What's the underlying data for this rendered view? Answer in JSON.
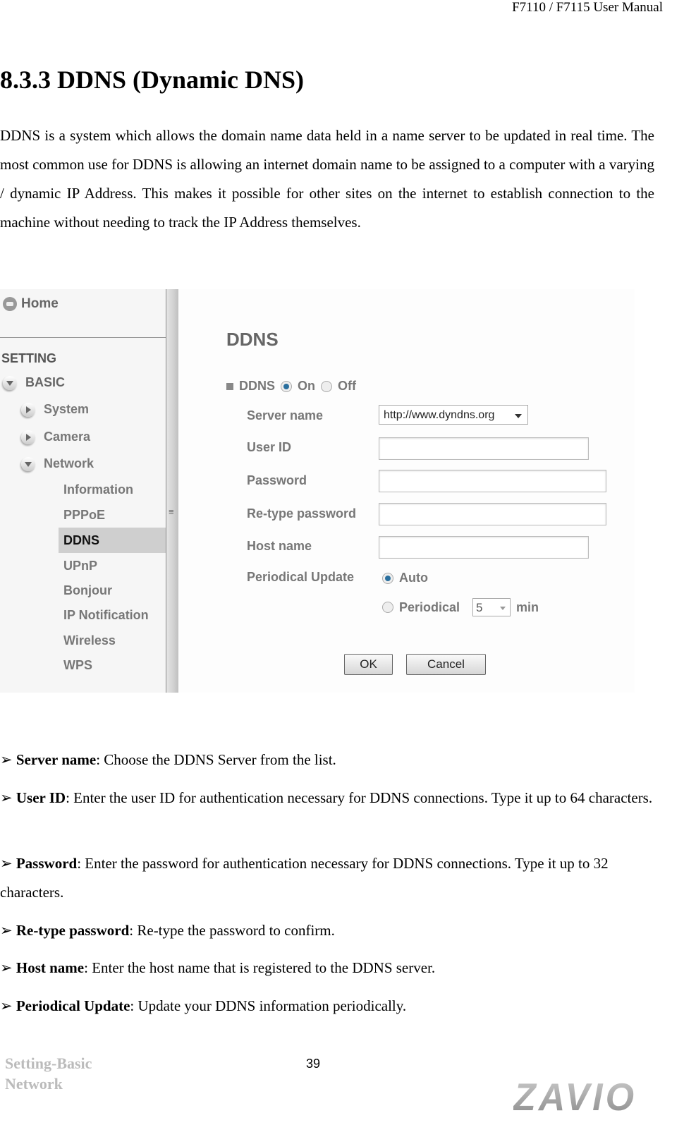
{
  "header": {
    "manual_title": "F7110 / F7115 User Manual"
  },
  "section": {
    "heading": "8.3.3 DDNS (Dynamic DNS)",
    "intro": "DDNS is a system which allows the domain name data held in a name server to be updated in real time. The most common use for DDNS is allowing an internet domain name to be assigned to a computer with a varying / dynamic IP Address. This makes it possible for other sites on the internet to establish connection to the machine without needing to track the IP Address themselves."
  },
  "screenshot": {
    "sidebar": {
      "home": "Home",
      "setting": "SETTING",
      "basic": "BASIC",
      "groups": [
        "System",
        "Camera",
        "Network"
      ],
      "network_items": [
        "Information",
        "PPPoE",
        "DDNS",
        "UPnP",
        "Bonjour",
        "IP Notification",
        "Wireless",
        "WPS"
      ],
      "active_item": "DDNS"
    },
    "form": {
      "title": "DDNS",
      "ddns_label": "DDNS",
      "on_label": "On",
      "off_label": "Off",
      "ddns_state": "On",
      "server_name_label": "Server name",
      "server_name_value": "http://www.dyndns.org",
      "user_id_label": "User ID",
      "user_id_value": "",
      "password_label": "Password",
      "password_value": "",
      "retype_label": "Re-type password",
      "retype_value": "",
      "host_label": "Host name",
      "host_value": "",
      "periodical_update_label": "Periodical Update",
      "auto_label": "Auto",
      "periodical_label": "Periodical",
      "update_mode": "Auto",
      "interval_value": "5",
      "min_label": "min",
      "ok_label": "OK",
      "cancel_label": "Cancel"
    }
  },
  "bullets": [
    {
      "term": "Server name",
      "text": ": Choose the DDNS Server from the list."
    },
    {
      "term": "User ID",
      "text": ": Enter the user ID for authentication necessary for DDNS connections. Type it up to 64 characters."
    },
    {
      "term": "Password",
      "text": ": Enter the password for authentication necessary for DDNS connections. Type it up to 32 characters."
    },
    {
      "term": "Re-type password",
      "text": ": Re-type the password to confirm."
    },
    {
      "term": "Host name",
      "text": ": Enter the host name that is registered to the DDNS server."
    },
    {
      "term": "Periodical Update",
      "text": ": Update your DDNS information periodically."
    }
  ],
  "bullet_marker": "➢",
  "footer": {
    "section_line1": "Setting-Basic",
    "section_line2": "Network",
    "page_number": "39",
    "logo_text": "ZAVIO"
  }
}
